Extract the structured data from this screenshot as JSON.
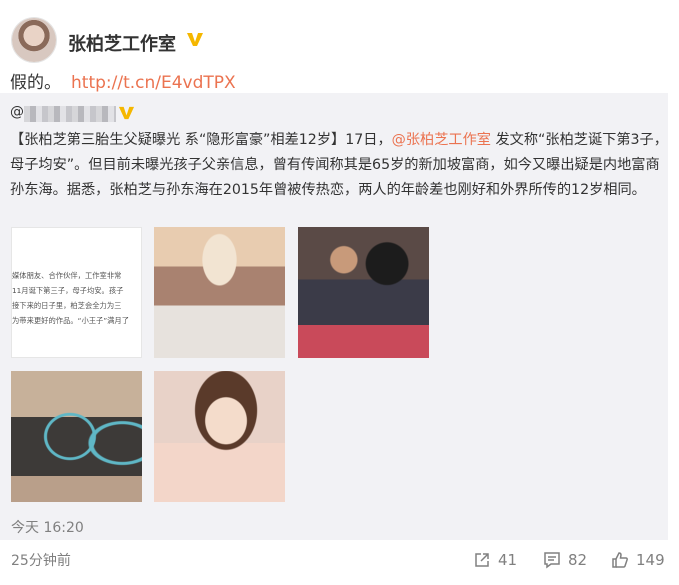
{
  "author": {
    "name": "张柏芝工作室"
  },
  "post": {
    "text": "假的。",
    "link": "http://t.cn/E4vdTPX",
    "time": "25分钟前"
  },
  "repost": {
    "prefix": "@",
    "text_part1": "【张柏芝第三胎生父疑曝光 系“隐形富豪”相差12岁】17日，",
    "mention": "@张柏芝工作室",
    "text_part2": " 发文称“张柏芝诞下第3子，母子均安”。但目前未曝光孩子父亲信息，曾有传闻称其是65岁的新加坡富商，如今又曝出疑是内地富商孙东海。据悉，张柏芝与孙东海在2015年曾被传热恋，两人的年龄差也刚好和外界所传的12岁相同。",
    "time": "今天 16:20",
    "statement_lines": [
      "媒体朋友、合作伙伴，工作室非常",
      "11月诞下第三子，母子均安。孩子",
      "接下来的日子里，柏芝会全力为三",
      "为带来更好的作品。“小王子”满月了"
    ]
  },
  "actions": {
    "share_count": "41",
    "comment_count": "82",
    "like_count": "149"
  },
  "colors": {
    "link": "#eb7350",
    "verified": "#f5b700",
    "muted": "#808080",
    "repost_bg": "#f2f2f5"
  }
}
